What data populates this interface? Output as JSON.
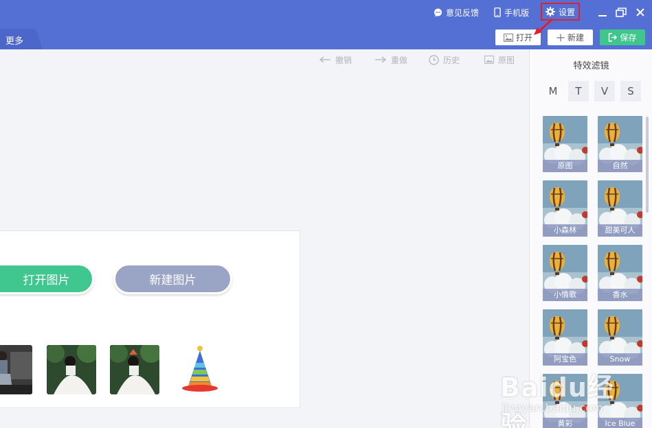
{
  "titlebar": {
    "feedback": "意见反馈",
    "mobile": "手机版",
    "settings": "设置"
  },
  "toolbar": {
    "tab_label": "更多",
    "open": "打开",
    "new": "新建",
    "save": "保存"
  },
  "history": {
    "undo": "撤销",
    "redo": "重做",
    "history": "历史",
    "original": "原图"
  },
  "welcome": {
    "open_image": "打开图片",
    "new_image": "新建图片"
  },
  "panel": {
    "title": "特效滤镜",
    "tabs": [
      "M",
      "T",
      "V",
      "S"
    ],
    "filters": [
      "原图",
      "自然",
      "小森林",
      "甜美可人",
      "小情歌",
      "香水",
      "阿宝色",
      "Snow",
      "黄彩",
      "Ice Blue"
    ]
  },
  "watermark": {
    "logo": "Baidu经验",
    "url": "jingyan.baidu.com"
  },
  "colors": {
    "brand": "#5570d4",
    "save": "#3fc78b",
    "open_pill": "#40c78f",
    "new_pill": "#9aa4c5",
    "highlight": "#e0202a"
  }
}
